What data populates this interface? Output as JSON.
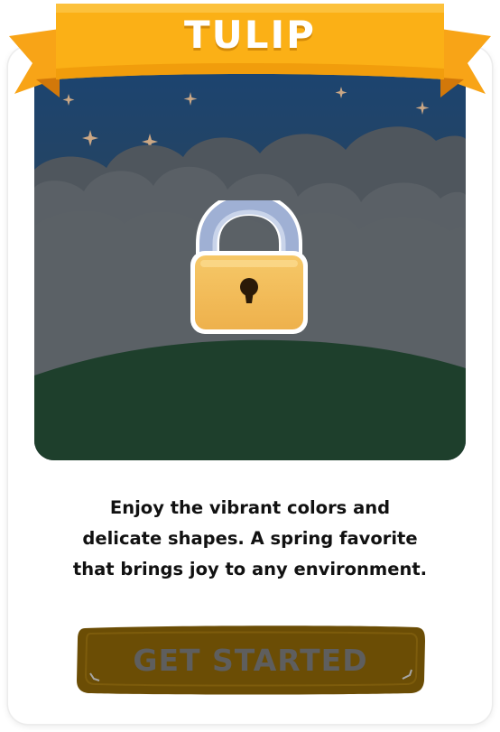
{
  "ribbon": {
    "title": "TULIP"
  },
  "description": {
    "lines": [
      "Enjoy the vibrant colors and",
      "delicate shapes. A spring favorite",
      "that brings joy to any environment."
    ]
  },
  "cta": {
    "label": "GET STARTED",
    "state": "locked"
  },
  "icons": {
    "lock": "padlock-icon",
    "stars": "sparkle-star-icon"
  },
  "colors": {
    "ribbon": "#fbb016",
    "ribbon_dark": "#e58c07",
    "sky_top": "#1c4470",
    "cloud": "#5a6066",
    "hill": "#1e3f2c",
    "lock_body": "#f1b54e",
    "lock_shackle": "#a9b9da",
    "button": "#6b4d05"
  }
}
